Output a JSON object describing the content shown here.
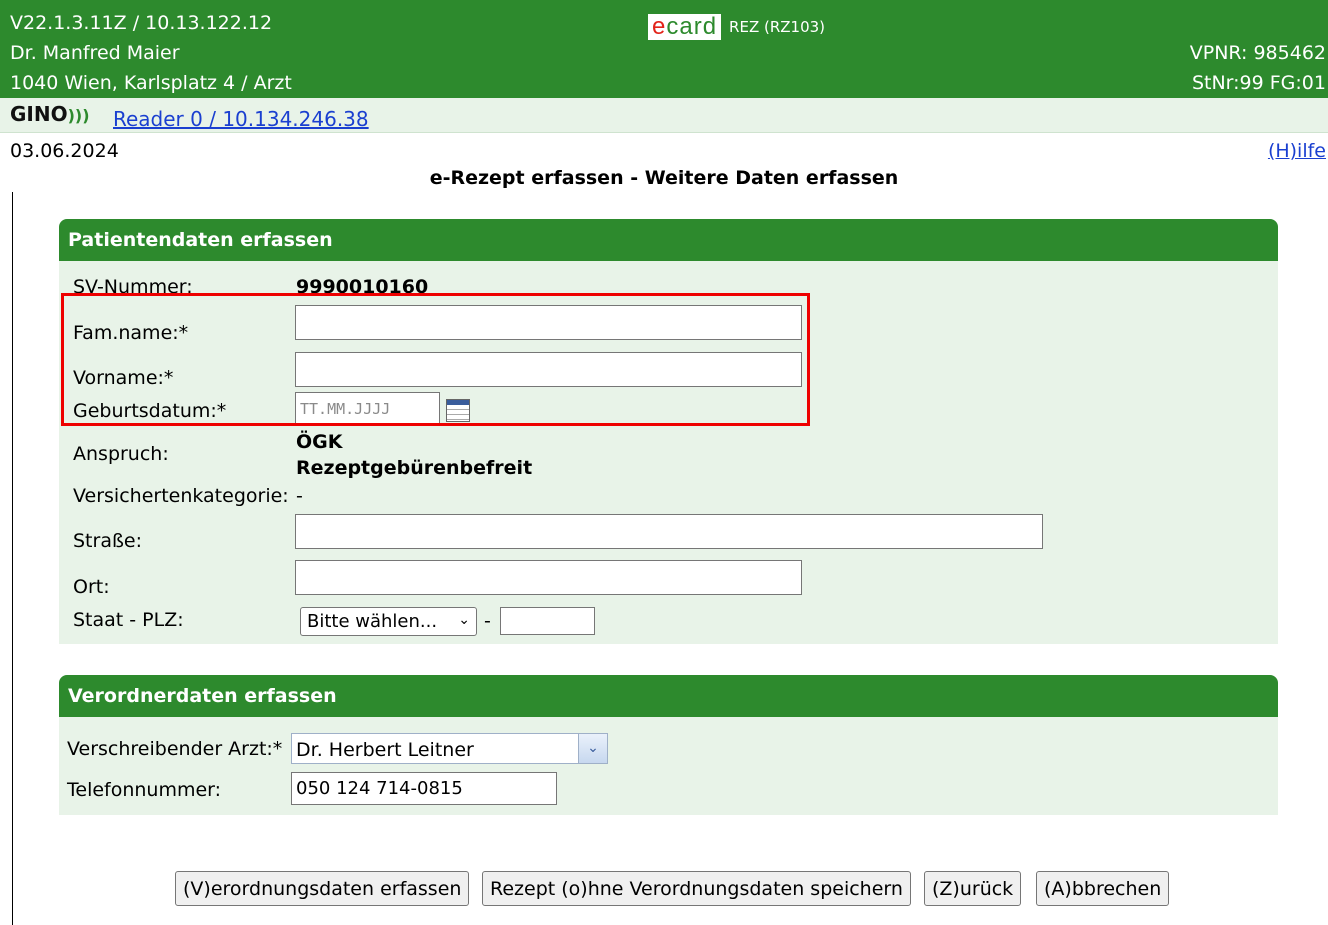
{
  "header": {
    "version": "V22.1.3.11Z / 10.13.122.12",
    "doctor": "Dr. Manfred Maier",
    "address": "1040 Wien, Karlsplatz 4 / Arzt",
    "logo_e": "e",
    "logo_card": "card",
    "app": "REZ (RZ103)",
    "vpnr": "VPNR: 985462",
    "stnr": "StNr:99 FG:01"
  },
  "reader": {
    "gino": "GINO",
    "link": "Reader 0 / 10.134.246.38"
  },
  "date": "03.06.2024",
  "help": "(H)ilfe",
  "page_title": "e-Rezept erfassen - Weitere Daten erfassen",
  "patient": {
    "title": "Patientendaten erfassen",
    "sv_label": "SV-Nummer:",
    "sv_value": "9990010160",
    "famname_label": "Fam.name:*",
    "famname_value": "",
    "vorname_label": "Vorname:*",
    "vorname_value": "",
    "geburtsdatum_label": "Geburtsdatum:*",
    "geburtsdatum_placeholder": "TT.MM.JJJJ",
    "anspruch_label": "Anspruch:",
    "anspruch_value1": "ÖGK",
    "anspruch_value2": "Rezeptgebürenbefreit",
    "kategorie_label": "Versichertenkategorie:",
    "kategorie_value": "-",
    "strasse_label": "Straße:",
    "ort_label": "Ort:",
    "staat_label": "Staat - PLZ:",
    "staat_select": "Bitte wählen...",
    "plz_sep": "-"
  },
  "prescriber": {
    "title": "Verordnerdaten erfassen",
    "arzt_label": "Verschreibender Arzt:*",
    "arzt_value": "Dr. Herbert Leitner",
    "tel_label": "Telefonnummer:",
    "tel_value": "050 124 714-0815"
  },
  "buttons": {
    "verordnung": "(V)erordnungsdaten erfassen",
    "ohne": "Rezept (o)hne Verordnungsdaten speichern",
    "zurueck": "(Z)urück",
    "abbrechen": "(A)bbrechen"
  },
  "colors": {
    "header_green": "#2d8a2d",
    "panel_green": "#e8f3e8",
    "highlight_red": "#ee0000"
  }
}
